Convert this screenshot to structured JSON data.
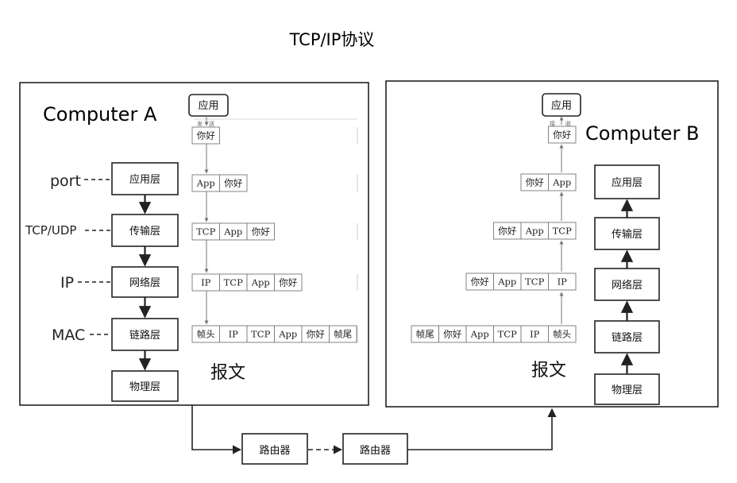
{
  "title": "TCP/IP协议",
  "computer_a": {
    "name": "Computer A",
    "app": "应用",
    "send": [
      "发",
      "送"
    ],
    "layers": [
      "应用层",
      "传输层",
      "网络层",
      "链路层",
      "物理层"
    ],
    "side_labels": [
      "port",
      "TCP/UDP",
      "IP",
      "MAC"
    ],
    "packets": [
      [
        "你好"
      ],
      [
        "App",
        "你好"
      ],
      [
        "TCP",
        "App",
        "你好"
      ],
      [
        "IP",
        "TCP",
        "App",
        "你好"
      ],
      [
        "帧头",
        "IP",
        "TCP",
        "App",
        "你好",
        "帧尾"
      ]
    ],
    "report": "报文"
  },
  "computer_b": {
    "name": "Computer B",
    "app": "应用",
    "recv": [
      "接",
      "收"
    ],
    "layers": [
      "应用层",
      "传输层",
      "网络层",
      "链路层",
      "物理层"
    ],
    "packets": [
      [
        "你好"
      ],
      [
        "你好",
        "App"
      ],
      [
        "你好",
        "App",
        "TCP"
      ],
      [
        "你好",
        "App",
        "TCP",
        "IP"
      ],
      [
        "帧尾",
        "你好",
        "App",
        "TCP",
        "IP",
        "帧头"
      ]
    ],
    "report": "报文"
  },
  "routers": [
    "路由器",
    "路由器"
  ]
}
